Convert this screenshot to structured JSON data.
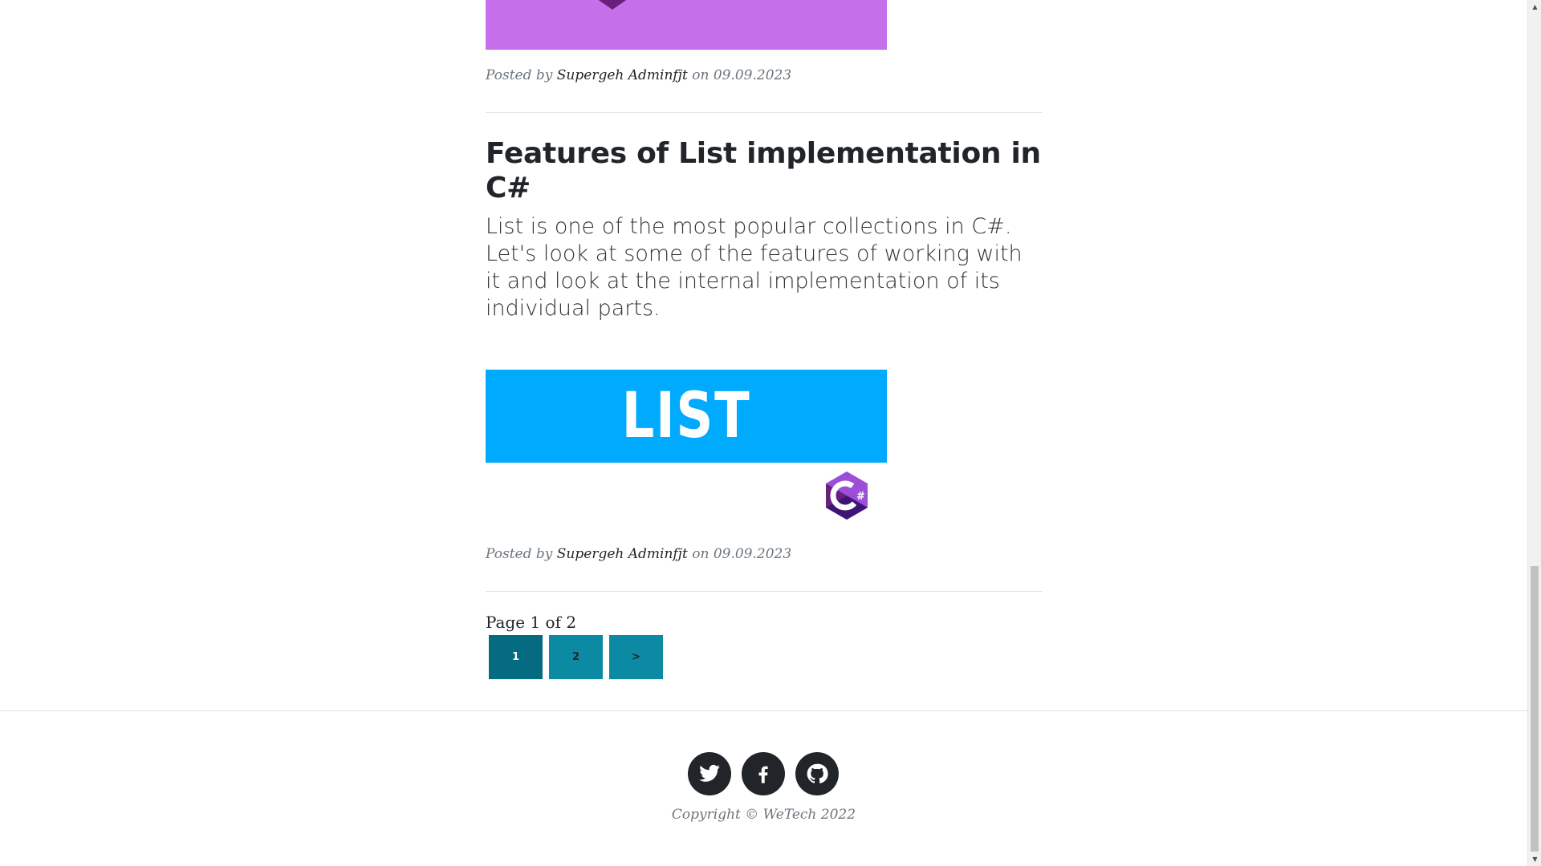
{
  "post_top": {
    "meta_prefix": "Posted by",
    "author": "Supergeh Adminfjt",
    "meta_on": "on",
    "date": "09.09.2023"
  },
  "post_list": {
    "title": "Features of List implementation in C#",
    "subtitle": "List is one of the most popular collections in C#. Let's look at some of the features of working with it and look at the internal implementation of its individual parts.",
    "image_text": "LIST",
    "meta_prefix": "Posted by",
    "author": "Supergeh Adminfjt",
    "meta_on": "on",
    "date": "09.09.2023"
  },
  "pagination": {
    "label": "Page 1 of 2",
    "buttons": [
      "1",
      "2",
      ">"
    ],
    "current": "1"
  },
  "footer": {
    "socials": [
      "twitter-icon",
      "facebook-icon",
      "github-icon"
    ],
    "copyright": "Copyright © WeTech 2022"
  },
  "colors": {
    "accent": "#0c8aa3",
    "accent_active": "#056b80",
    "list_banner": "#00abff",
    "top_thumb": "#c56feb",
    "csharp_purple": "#68217a"
  }
}
